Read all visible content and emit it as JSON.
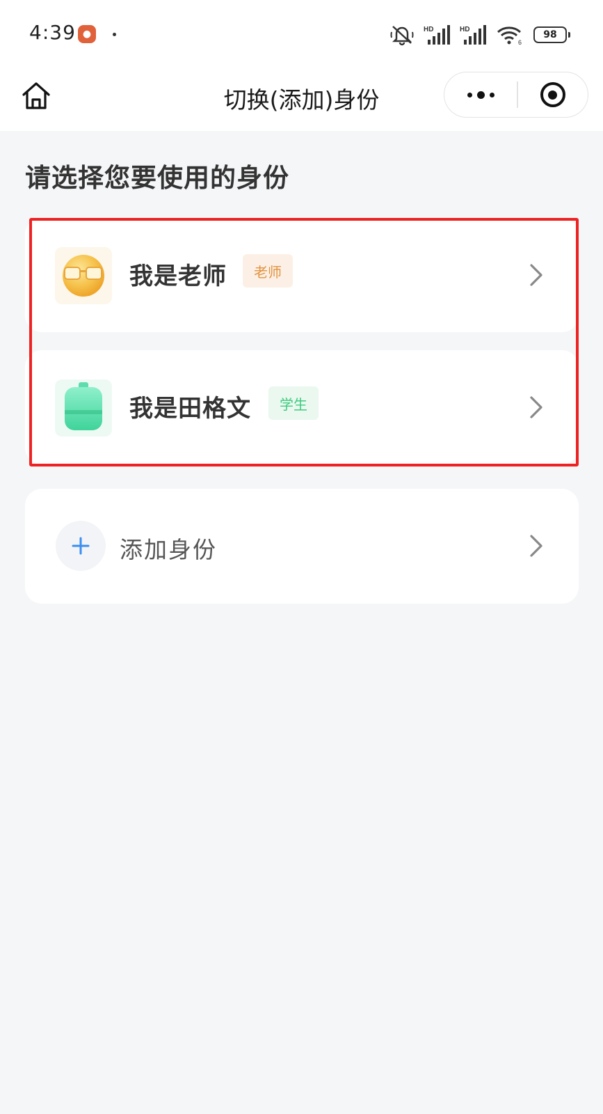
{
  "status_bar": {
    "time": "4:39",
    "network_1": "HD",
    "network_2": "HD",
    "wifi_sub": "6",
    "battery": "98"
  },
  "header": {
    "title": "切换(添加)身份",
    "home_icon": "home-icon",
    "more_icon": "more-dots-icon",
    "close_icon": "target-circle-icon"
  },
  "main": {
    "section_title": "请选择您要使用的身份",
    "identities": [
      {
        "name": "我是老师",
        "tag": "老师",
        "avatar_icon": "teacher-sunglasses-avatar-icon",
        "tag_color": "#e2923f",
        "tag_bg": "#fcf0e6"
      },
      {
        "name": "我是田格文",
        "tag": "学生",
        "avatar_icon": "student-backpack-avatar-icon",
        "tag_color": "#3ecb7e",
        "tag_bg": "#eaf8f0"
      }
    ],
    "add": {
      "label": "添加身份",
      "icon": "plus-icon"
    }
  },
  "colors": {
    "background": "#f5f6f8",
    "highlight": "#ee2222",
    "plus": "#3a8ef0"
  }
}
